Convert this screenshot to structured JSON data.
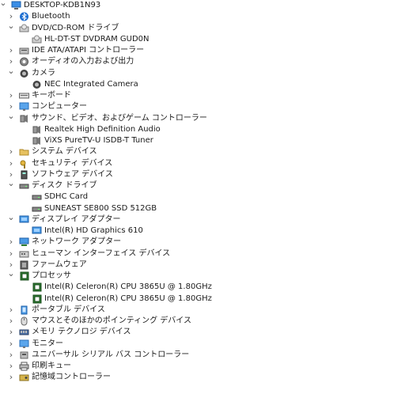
{
  "tree": [
    {
      "label": "DESKTOP-KDB1N93",
      "level": 0,
      "state": "expanded",
      "icon": "computer-icon"
    },
    {
      "label": "Bluetooth",
      "level": 1,
      "state": "collapsed",
      "icon": "bluetooth-icon"
    },
    {
      "label": "DVD/CD-ROM ドライブ",
      "level": 1,
      "state": "expanded",
      "icon": "dvd-drive-icon"
    },
    {
      "label": "HL-DT-ST DVDRAM GUD0N",
      "level": 2,
      "state": "leaf",
      "icon": "dvd-drive-icon"
    },
    {
      "label": "IDE ATA/ATAPI コントローラー",
      "level": 1,
      "state": "collapsed",
      "icon": "ide-controller-icon"
    },
    {
      "label": "オーディオの入力および出力",
      "level": 1,
      "state": "collapsed",
      "icon": "audio-io-icon"
    },
    {
      "label": "カメラ",
      "level": 1,
      "state": "expanded",
      "icon": "camera-icon"
    },
    {
      "label": "NEC Integrated Camera",
      "level": 2,
      "state": "leaf",
      "icon": "camera-icon"
    },
    {
      "label": "キーボード",
      "level": 1,
      "state": "collapsed",
      "icon": "keyboard-icon"
    },
    {
      "label": "コンピューター",
      "level": 1,
      "state": "collapsed",
      "icon": "monitor-icon"
    },
    {
      "label": "サウンド、ビデオ、およびゲーム コントローラー",
      "level": 1,
      "state": "expanded",
      "icon": "speaker-icon"
    },
    {
      "label": "Realtek High Definition Audio",
      "level": 2,
      "state": "leaf",
      "icon": "speaker-icon"
    },
    {
      "label": "ViXS PureTV-U ISDB-T Tuner",
      "level": 2,
      "state": "leaf",
      "icon": "speaker-icon"
    },
    {
      "label": "システム デバイス",
      "level": 1,
      "state": "collapsed",
      "icon": "folder-icon"
    },
    {
      "label": "セキュリティ デバイス",
      "level": 1,
      "state": "collapsed",
      "icon": "security-key-icon"
    },
    {
      "label": "ソフトウェア デバイス",
      "level": 1,
      "state": "collapsed",
      "icon": "software-device-icon"
    },
    {
      "label": "ディスク ドライブ",
      "level": 1,
      "state": "expanded",
      "icon": "disk-drive-icon"
    },
    {
      "label": "SDHC Card",
      "level": 2,
      "state": "leaf",
      "icon": "disk-drive-icon"
    },
    {
      "label": "SUNEAST SE800 SSD 512GB",
      "level": 2,
      "state": "leaf",
      "icon": "disk-drive-icon"
    },
    {
      "label": "ディスプレイ アダプター",
      "level": 1,
      "state": "expanded",
      "icon": "display-adapter-icon"
    },
    {
      "label": "Intel(R) HD Graphics 610",
      "level": 2,
      "state": "leaf",
      "icon": "display-adapter-icon"
    },
    {
      "label": "ネットワーク アダプター",
      "level": 1,
      "state": "collapsed",
      "icon": "network-adapter-icon"
    },
    {
      "label": "ヒューマン インターフェイス デバイス",
      "level": 1,
      "state": "collapsed",
      "icon": "hid-icon"
    },
    {
      "label": "ファームウェア",
      "level": 1,
      "state": "collapsed",
      "icon": "firmware-icon"
    },
    {
      "label": "プロセッサ",
      "level": 1,
      "state": "expanded",
      "icon": "processor-icon"
    },
    {
      "label": "Intel(R) Celeron(R) CPU 3865U @ 1.80GHz",
      "level": 2,
      "state": "leaf",
      "icon": "processor-icon"
    },
    {
      "label": "Intel(R) Celeron(R) CPU 3865U @ 1.80GHz",
      "level": 2,
      "state": "leaf",
      "icon": "processor-icon"
    },
    {
      "label": "ポータブル デバイス",
      "level": 1,
      "state": "collapsed",
      "icon": "portable-device-icon"
    },
    {
      "label": "マウスとそのほかのポインティング デバイス",
      "level": 1,
      "state": "collapsed",
      "icon": "mouse-icon"
    },
    {
      "label": "メモリ テクノロジ デバイス",
      "level": 1,
      "state": "collapsed",
      "icon": "memory-icon"
    },
    {
      "label": "モニター",
      "level": 1,
      "state": "collapsed",
      "icon": "monitor-icon"
    },
    {
      "label": "ユニバーサル シリアル バス コントローラー",
      "level": 1,
      "state": "collapsed",
      "icon": "usb-icon"
    },
    {
      "label": "印刷キュー",
      "level": 1,
      "state": "collapsed",
      "icon": "printer-icon"
    },
    {
      "label": "記憶域コントローラー",
      "level": 1,
      "state": "collapsed",
      "icon": "storage-controller-icon"
    }
  ]
}
